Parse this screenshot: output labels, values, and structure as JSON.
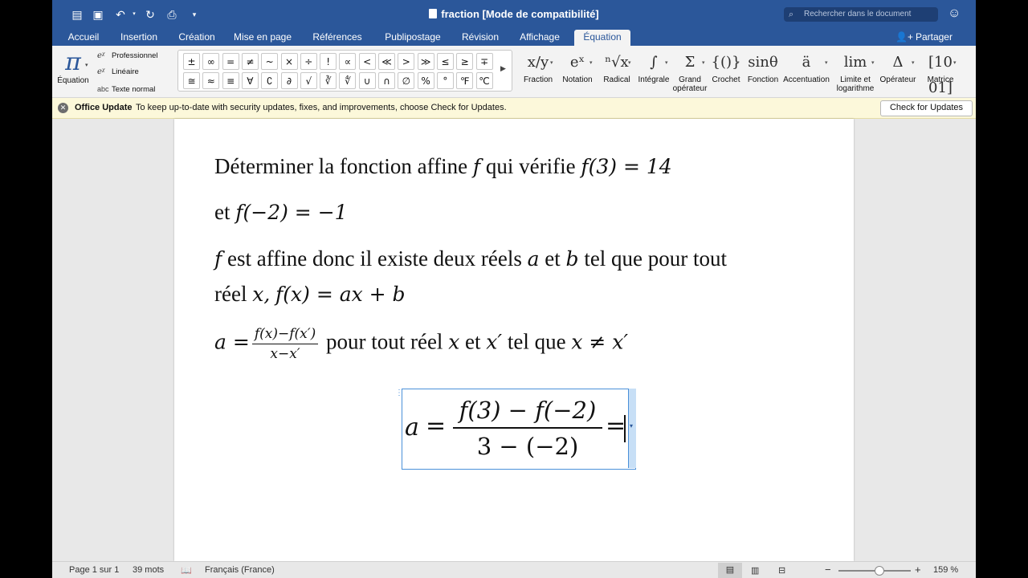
{
  "titlebar": {
    "title": "fraction [Mode de compatibilité]",
    "search_placeholder": "Rechercher dans le document"
  },
  "tabs": [
    {
      "label": "Accueil"
    },
    {
      "label": "Insertion"
    },
    {
      "label": "Création"
    },
    {
      "label": "Mise en page"
    },
    {
      "label": "Références"
    },
    {
      "label": "Publipostage"
    },
    {
      "label": "Révision"
    },
    {
      "label": "Affichage"
    },
    {
      "label": "Équation"
    }
  ],
  "share_label": "Partager",
  "ribbon": {
    "equation_label": "Équation",
    "formats": [
      {
        "label": "Professionnel"
      },
      {
        "label": "Linéaire"
      },
      {
        "label": "Texte normal"
      }
    ],
    "symbols_row1": [
      "±",
      "∞",
      "=",
      "≠",
      "~",
      "×",
      "÷",
      "!",
      "∝",
      "<",
      "≪",
      ">",
      "≫",
      "≤",
      "≥",
      "∓"
    ],
    "symbols_row2": [
      "≅",
      "≈",
      "≡",
      "∀",
      "∁",
      "∂",
      "√",
      "∛",
      "∜",
      "∪",
      "∩",
      "∅",
      "%",
      "°",
      "℉",
      "℃"
    ],
    "structures": [
      {
        "label": "Fraction",
        "glyph": "x/y"
      },
      {
        "label": "Notation",
        "glyph": "eˣ"
      },
      {
        "label": "Radical",
        "glyph": "ⁿ√x"
      },
      {
        "label": "Intégrale",
        "glyph": "∫"
      },
      {
        "label": "Grand opérateur",
        "glyph": "Σ"
      },
      {
        "label": "Crochet",
        "glyph": "{()}"
      },
      {
        "label": "Fonction",
        "glyph": "sinθ"
      },
      {
        "label": "Accentuation",
        "glyph": "ä"
      },
      {
        "label": "Limite et logarithme",
        "glyph": "lim"
      },
      {
        "label": "Opérateur",
        "glyph": "Δ"
      },
      {
        "label": "Matrice",
        "glyph": "[10 01]"
      }
    ]
  },
  "update": {
    "title": "Office Update",
    "message": "To keep up-to-date with security updates, fixes, and improvements, choose Check for Updates.",
    "button": "Check for Updates"
  },
  "document": {
    "line1_text": "Déterminer la fonction affine",
    "line1_f": "f",
    "line1_mid": "qui vérifie",
    "line1_eq": "f(3) = 14",
    "line2_text": "et",
    "line2_eq": "f(−2) = −1",
    "line3_f": "f",
    "line3_a": "est affine donc il existe deux réels",
    "line3_var_a": "a",
    "line3_et": "et",
    "line3_var_b": "b",
    "line3_b": "tel que pour tout",
    "line4_a": "réel",
    "line4_x": "x,",
    "line4_eq": "f(x) = ax + b",
    "line5_lhs": "a =",
    "line5_num": "f(x)−f(x′)",
    "line5_den": "x−x′",
    "line5_text": "pour tout réel",
    "line5_x": "x",
    "line5_et": "et",
    "line5_xp": "x′",
    "line5_tel": "tel que",
    "line5_cond": "x ≠ x′",
    "eq_lhs": "a",
    "eq_equals": "=",
    "eq_num": "f(3) − f(−2)",
    "eq_den": "3 − (−2)",
    "eq_trailing": "="
  },
  "status": {
    "page": "Page 1 sur 1",
    "words": "39 mots",
    "language": "Français (France)",
    "zoom": "159 %",
    "zoom_minus": "−",
    "zoom_plus": "+"
  }
}
